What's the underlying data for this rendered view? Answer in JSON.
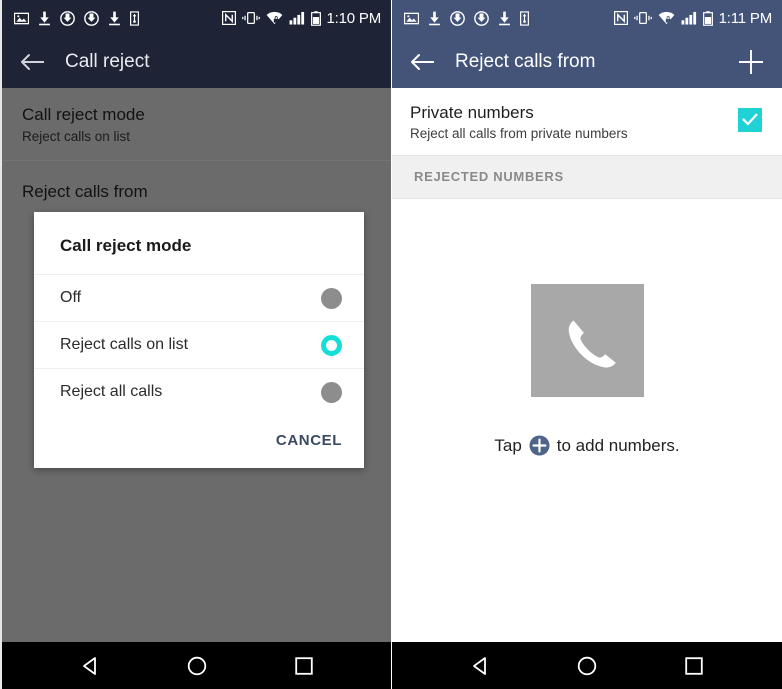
{
  "left_screen": {
    "status_bar": {
      "icons": [
        "image-icon",
        "download-icon",
        "sync-icon",
        "sync-icon",
        "download-icon",
        "usb-icon"
      ],
      "right_icons": [
        "nfc-icon",
        "vibrate-icon",
        "wifi-secure-icon",
        "signal-icon",
        "battery-icon"
      ],
      "time": "1:10 PM"
    },
    "action_bar": {
      "back_icon": "back-arrow-icon",
      "title": "Call reject"
    },
    "settings": [
      {
        "title": "Call reject mode",
        "subtitle": "Reject calls on list"
      },
      {
        "title": "Reject calls from",
        "subtitle": ""
      }
    ],
    "dialog": {
      "title": "Call reject mode",
      "options": [
        {
          "label": "Off",
          "selected": false
        },
        {
          "label": "Reject calls on list",
          "selected": true
        },
        {
          "label": "Reject all calls",
          "selected": false
        }
      ],
      "cancel_label": "CANCEL"
    },
    "nav_bar": {
      "back": "nav-back-icon",
      "home": "nav-home-icon",
      "recents": "nav-recents-icon"
    }
  },
  "right_screen": {
    "status_bar": {
      "icons": [
        "image-icon",
        "download-icon",
        "sync-icon",
        "sync-icon",
        "download-icon",
        "usb-icon"
      ],
      "right_icons": [
        "nfc-icon",
        "vibrate-icon",
        "wifi-secure-icon",
        "signal-icon",
        "battery-icon"
      ],
      "time": "1:11 PM"
    },
    "action_bar": {
      "back_icon": "back-arrow-icon",
      "title": "Reject calls from",
      "add_icon": "plus-icon"
    },
    "private_numbers": {
      "title": "Private numbers",
      "subtitle": "Reject all calls from private numbers",
      "checked": true
    },
    "section_header": "REJECTED NUMBERS",
    "empty_state": {
      "icon": "phone-handset-icon",
      "text_before": "Tap",
      "inline_icon": "circle-plus-icon",
      "text_after": "to add numbers."
    },
    "nav_bar": {
      "back": "nav-back-icon",
      "home": "nav-home-icon",
      "recents": "nav-recents-icon"
    }
  },
  "colors": {
    "left_header": "#1e2435",
    "right_header": "#445479",
    "left_body": "#6b6b6b",
    "accent_cyan": "#13dfd9",
    "checkbox_cyan": "#1ed2d6",
    "cancel_blue": "#3b4a63",
    "empty_icon_gray": "#a8a8a8",
    "plus_blue": "#4e6488",
    "nav_black": "#000000"
  }
}
